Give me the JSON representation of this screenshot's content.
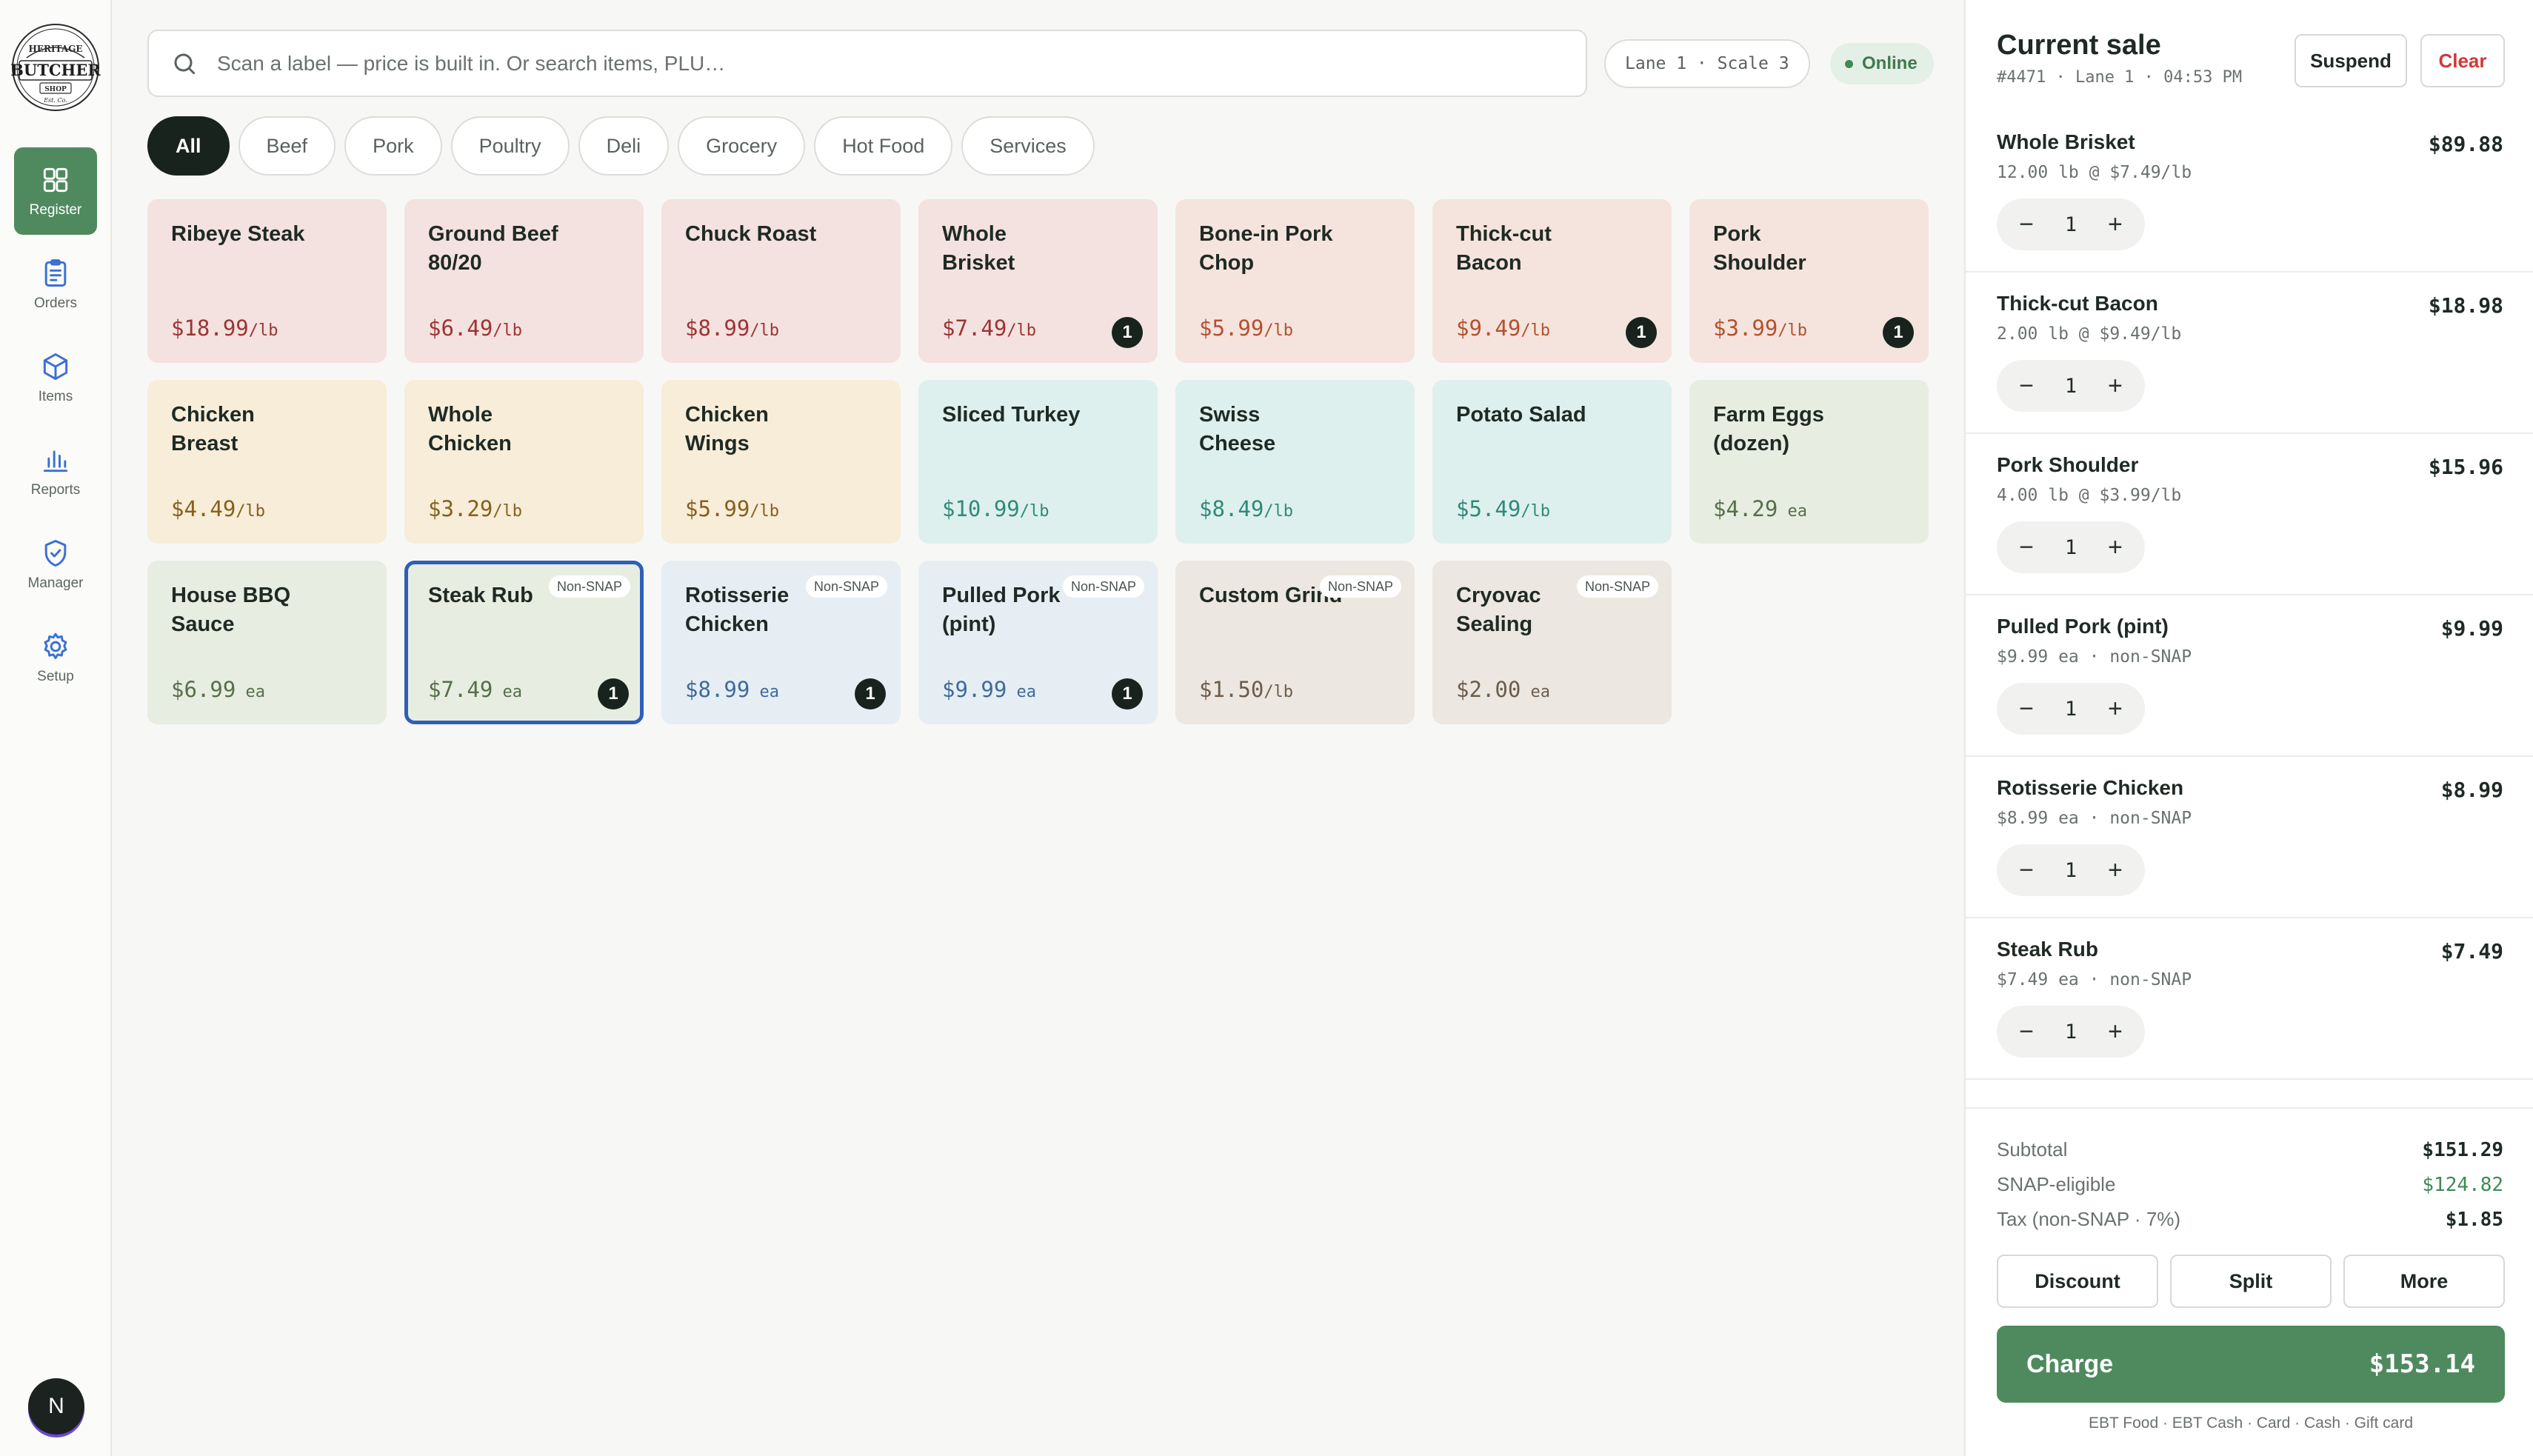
{
  "brand": {
    "logo_lines": [
      "HERITAGE",
      "BUTCHER",
      "SHOP",
      "Est. Co."
    ]
  },
  "nav": [
    {
      "label": "Register",
      "icon": "grid-icon",
      "active": true
    },
    {
      "label": "Orders",
      "icon": "clipboard-icon",
      "active": false
    },
    {
      "label": "Items",
      "icon": "box-icon",
      "active": false
    },
    {
      "label": "Reports",
      "icon": "bar-chart-icon",
      "active": false
    },
    {
      "label": "Manager",
      "icon": "shield-check-icon",
      "active": false
    },
    {
      "label": "Setup",
      "icon": "gear-icon",
      "active": false
    }
  ],
  "user": {
    "initial": "N"
  },
  "search": {
    "placeholder": "Scan a label — price is built in. Or search items, PLU…",
    "value": ""
  },
  "lane": {
    "label": "Lane 1 · Scale 3"
  },
  "status": {
    "label": "Online",
    "color": "#3e8a55"
  },
  "categories": [
    "All",
    "Beef",
    "Pork",
    "Poultry",
    "Deli",
    "Grocery",
    "Hot Food",
    "Services"
  ],
  "active_category": "All",
  "products": [
    {
      "name": "Ribeye Steak",
      "price": "$18.99",
      "unit": "/lb",
      "group": "beef"
    },
    {
      "name": "Ground Beef\n80/20",
      "price": "$6.49",
      "unit": "/lb",
      "group": "beef"
    },
    {
      "name": "Chuck Roast",
      "price": "$8.99",
      "unit": "/lb",
      "group": "beef"
    },
    {
      "name": "Whole\nBrisket",
      "price": "$7.49",
      "unit": "/lb",
      "group": "beef",
      "count": "1"
    },
    {
      "name": "Bone-in Pork\nChop",
      "price": "$5.99",
      "unit": "/lb",
      "group": "pork"
    },
    {
      "name": "Thick-cut\nBacon",
      "price": "$9.49",
      "unit": "/lb",
      "group": "pork",
      "count": "1"
    },
    {
      "name": "Pork\nShoulder",
      "price": "$3.99",
      "unit": "/lb",
      "group": "pork",
      "count": "1"
    },
    {
      "name": "Chicken\nBreast",
      "price": "$4.49",
      "unit": "/lb",
      "group": "poultry"
    },
    {
      "name": "Whole\nChicken",
      "price": "$3.29",
      "unit": "/lb",
      "group": "poultry"
    },
    {
      "name": "Chicken\nWings",
      "price": "$5.99",
      "unit": "/lb",
      "group": "poultry"
    },
    {
      "name": "Sliced Turkey",
      "price": "$10.99",
      "unit": "/lb",
      "group": "deli"
    },
    {
      "name": "Swiss\nCheese",
      "price": "$8.49",
      "unit": "/lb",
      "group": "deli"
    },
    {
      "name": "Potato Salad",
      "price": "$5.49",
      "unit": "/lb",
      "group": "deli"
    },
    {
      "name": "Farm Eggs\n(dozen)",
      "price": "$4.29",
      "unit": " ea",
      "group": "grocery"
    },
    {
      "name": "House BBQ\nSauce",
      "price": "$6.99",
      "unit": " ea",
      "group": "grocery"
    },
    {
      "name": "Steak Rub",
      "price": "$7.49",
      "unit": " ea",
      "group": "grocery",
      "count": "1",
      "tag": "Non-SNAP",
      "selected": true
    },
    {
      "name": "Rotisserie\nChicken",
      "price": "$8.99",
      "unit": " ea",
      "group": "hotfood",
      "count": "1",
      "tag": "Non-SNAP"
    },
    {
      "name": "Pulled Pork\n(pint)",
      "price": "$9.99",
      "unit": " ea",
      "group": "hotfood",
      "count": "1",
      "tag": "Non-SNAP"
    },
    {
      "name": "Custom Grind",
      "price": "$1.50",
      "unit": "/lb",
      "group": "services",
      "tag": "Non-SNAP"
    },
    {
      "name": "Cryovac\nSealing",
      "price": "$2.00",
      "unit": " ea",
      "group": "services",
      "tag": "Non-SNAP"
    }
  ],
  "sale": {
    "title": "Current sale",
    "meta": "#4471 · Lane 1 · 04:53 PM",
    "suspend_label": "Suspend",
    "clear_label": "Clear",
    "lines": [
      {
        "name": "Whole Brisket",
        "detail": "12.00 lb @ $7.49/lb",
        "total": "$89.88",
        "qty": "1"
      },
      {
        "name": "Thick-cut Bacon",
        "detail": "2.00 lb @ $9.49/lb",
        "total": "$18.98",
        "qty": "1"
      },
      {
        "name": "Pork Shoulder",
        "detail": "4.00 lb @ $3.99/lb",
        "total": "$15.96",
        "qty": "1"
      },
      {
        "name": "Pulled Pork (pint)",
        "detail": "$9.99 ea · non-SNAP",
        "total": "$9.99",
        "qty": "1"
      },
      {
        "name": "Rotisserie Chicken",
        "detail": "$8.99 ea · non-SNAP",
        "total": "$8.99",
        "qty": "1"
      },
      {
        "name": "Steak Rub",
        "detail": "$7.49 ea · non-SNAP",
        "total": "$7.49",
        "qty": "1"
      }
    ],
    "totals": {
      "subtotal_label": "Subtotal",
      "subtotal": "$151.29",
      "snap_label": "SNAP-eligible",
      "snap": "$124.82",
      "tax_label": "Tax (non-SNAP · 7%)",
      "tax": "$1.85"
    },
    "actions": [
      "Discount",
      "Split",
      "More"
    ],
    "charge_label": "Charge",
    "charge_amount": "$153.14",
    "tenders": "EBT Food · EBT Cash · Card · Cash · Gift card"
  },
  "colors": {
    "accent": "#4f8a5f",
    "dark": "#17231c",
    "danger": "#d13838",
    "selected_outline": "#2f5fb8"
  }
}
